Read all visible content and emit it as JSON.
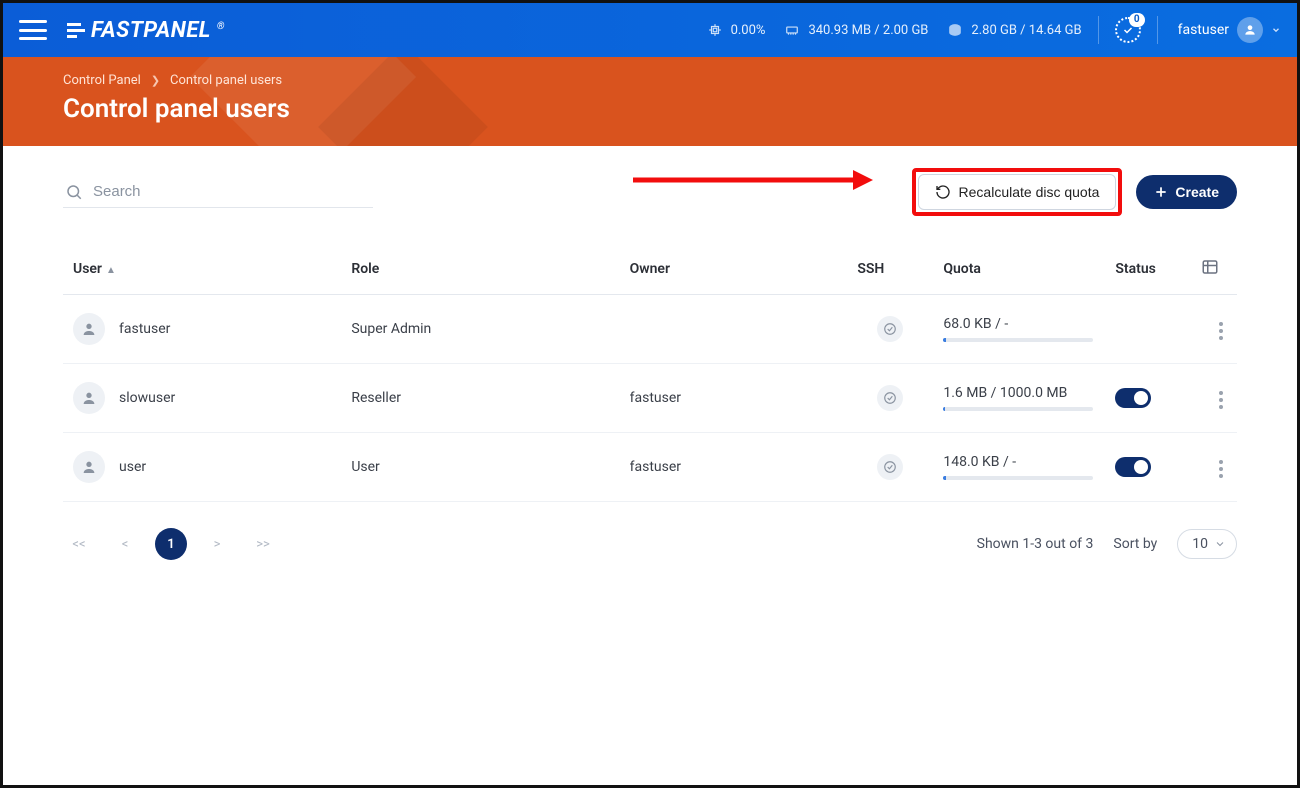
{
  "topbar": {
    "cpu": "0.00%",
    "ram": "340.93 MB / 2.00 GB",
    "disk": "2.80 GB / 14.64 GB",
    "badge": "0",
    "username": "fastuser",
    "logo_text": "FASTPANEL",
    "logo_reg": "®"
  },
  "hero": {
    "breadcrumb_root": "Control Panel",
    "breadcrumb_current": "Control panel users",
    "title": "Control panel users"
  },
  "toolbar": {
    "search_placeholder": "Search",
    "recalc_label": "Recalculate disc quota",
    "create_label": "Create"
  },
  "table": {
    "headers": {
      "user": "User",
      "role": "Role",
      "owner": "Owner",
      "ssh": "SSH",
      "quota": "Quota",
      "status": "Status"
    },
    "rows": [
      {
        "user": "fastuser",
        "role": "Super Admin",
        "owner": "",
        "quota": "68.0 KB / -",
        "quota_pct": 2,
        "has_status": false
      },
      {
        "user": "slowuser",
        "role": "Reseller",
        "owner": "fastuser",
        "quota": "1.6 MB / 1000.0 MB",
        "quota_pct": 1,
        "has_status": true
      },
      {
        "user": "user",
        "role": "User",
        "owner": "fastuser",
        "quota": "148.0 KB / -",
        "quota_pct": 2,
        "has_status": true
      }
    ]
  },
  "footer": {
    "page": "1",
    "shown": "Shown 1-3 out of 3",
    "sortby_label": "Sort by",
    "sortby_value": "10"
  }
}
